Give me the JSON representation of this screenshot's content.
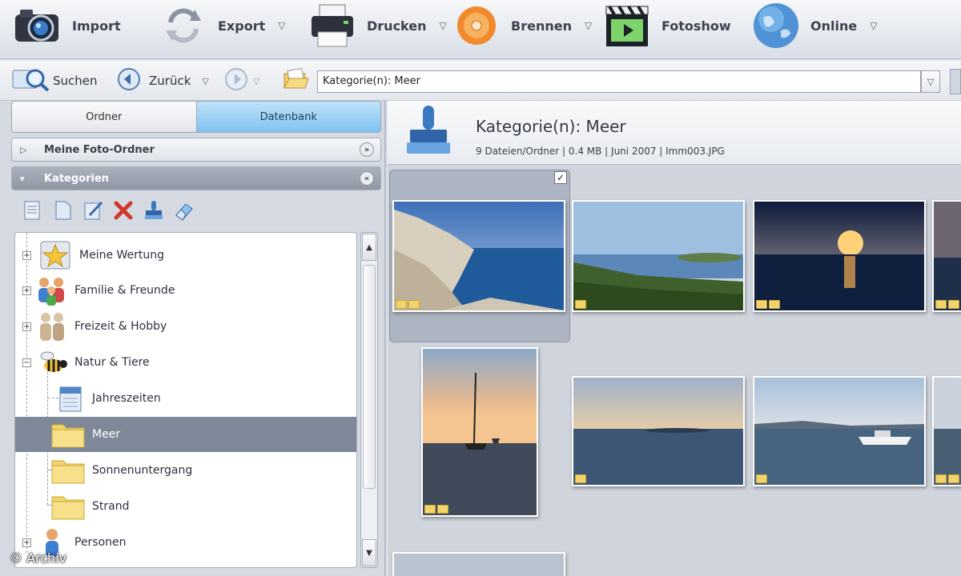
{
  "toolbar": {
    "items": [
      {
        "label": "Import",
        "icon": "camera-icon",
        "has_menu": false
      },
      {
        "label": "Export",
        "icon": "export-arrows-icon",
        "has_menu": true
      },
      {
        "label": "Drucken",
        "icon": "printer-icon",
        "has_menu": true
      },
      {
        "label": "Brennen",
        "icon": "disc-icon",
        "has_menu": true
      },
      {
        "label": "Fotoshow",
        "icon": "clapper-icon",
        "has_menu": false
      },
      {
        "label": "Online",
        "icon": "globe-icon",
        "has_menu": true
      }
    ],
    "menu_arrow": "▽"
  },
  "nav": {
    "search_label": "Suchen",
    "back_label": "Zurück",
    "arrow": "▽",
    "address_value": "Kategorie(n): Meer",
    "address_dropdown": "▽"
  },
  "left_panel": {
    "tabs": {
      "folders": "Ordner",
      "database": "Datenbank"
    },
    "sections": {
      "my_folders": "Meine Foto-Ordner",
      "categories": "Kategorien"
    },
    "section_arrows": {
      "collapsed": "▷",
      "expanded": "▾"
    },
    "section_buttons": {
      "collapse": "«",
      "expand": "»"
    },
    "tree": [
      {
        "label": "Meine Wertung",
        "icon": "star-icon",
        "level": 0,
        "expander": "+"
      },
      {
        "label": "Familie & Freunde",
        "icon": "people-icon",
        "level": 0,
        "expander": "+"
      },
      {
        "label": "Freizeit & Hobby",
        "icon": "figures-icon",
        "level": 0,
        "expander": "+"
      },
      {
        "label": "Natur & Tiere",
        "icon": "bee-icon",
        "level": 0,
        "expander": "−"
      },
      {
        "label": "Jahreszeiten",
        "icon": "calendar-icon",
        "level": 1,
        "expander": ""
      },
      {
        "label": "Meer",
        "icon": "folder-icon",
        "level": 1,
        "expander": "",
        "selected": true
      },
      {
        "label": "Sonnenuntergang",
        "icon": "folder-icon",
        "level": 1,
        "expander": ""
      },
      {
        "label": "Strand",
        "icon": "folder-icon",
        "level": 1,
        "expander": ""
      },
      {
        "label": "Personen",
        "icon": "person-icon",
        "level": 0,
        "expander": "+"
      }
    ]
  },
  "info": {
    "title": "Kategorie(n): Meer",
    "meta": "9 Dateien/Ordner | 0.4 MB | Juni 2007 | Imm003.JPG"
  },
  "thumbnails": [
    {
      "name": "coast-cliffs",
      "selected": true
    },
    {
      "name": "green-headland"
    },
    {
      "name": "sunset-sea"
    },
    {
      "name": "sailboat-dusk"
    },
    {
      "name": "calm-bay"
    },
    {
      "name": "boat-harbor"
    }
  ],
  "checkmark": "✓",
  "scroll_arrows": {
    "up": "▲",
    "down": "▼"
  },
  "copyright": "© Archiv",
  "colors": {
    "selection": "#7e8898",
    "tab_active": "#8ecbf3",
    "folder": "#f2d46a"
  }
}
